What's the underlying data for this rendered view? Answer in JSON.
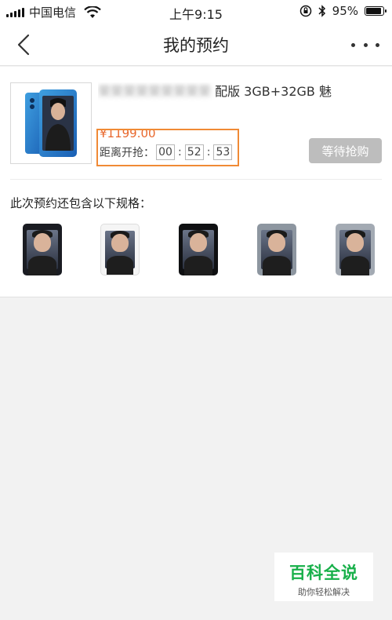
{
  "status_bar": {
    "carrier": "中国电信",
    "time": "上午9:15",
    "battery_percent": "95%",
    "battery_level": 0.95,
    "icons": [
      "signal-icon",
      "wifi-icon",
      "rotation-lock-icon",
      "bluetooth-icon",
      "battery-icon"
    ]
  },
  "nav": {
    "title": "我的预约",
    "back_icon": "chevron-left-icon",
    "more_icon": "more-dots-icon"
  },
  "reservation": {
    "product_name_visible": "配版 3GB+32GB 魅",
    "price": "¥1199.00",
    "countdown_label": "距离开抢：",
    "countdown": {
      "hours": "00",
      "minutes": "52",
      "seconds": "53"
    },
    "action_button": "等待抢购",
    "highlight_color": "#f08a35",
    "price_color": "#e8672c"
  },
  "specs": {
    "title": "此次预约还包含以下规格：",
    "variants": [
      {
        "color": "#1a1c22",
        "name": "black"
      },
      {
        "color": "#f5f5f5",
        "name": "white"
      },
      {
        "color": "#0f1012",
        "name": "black-glossy"
      },
      {
        "color": "#8d96a0",
        "name": "gray"
      },
      {
        "color": "#a3aab3",
        "name": "silver-gray"
      }
    ]
  },
  "watermark": {
    "main": "百科全说",
    "sub": "助你轻松解决",
    "color": "#18b04a"
  }
}
